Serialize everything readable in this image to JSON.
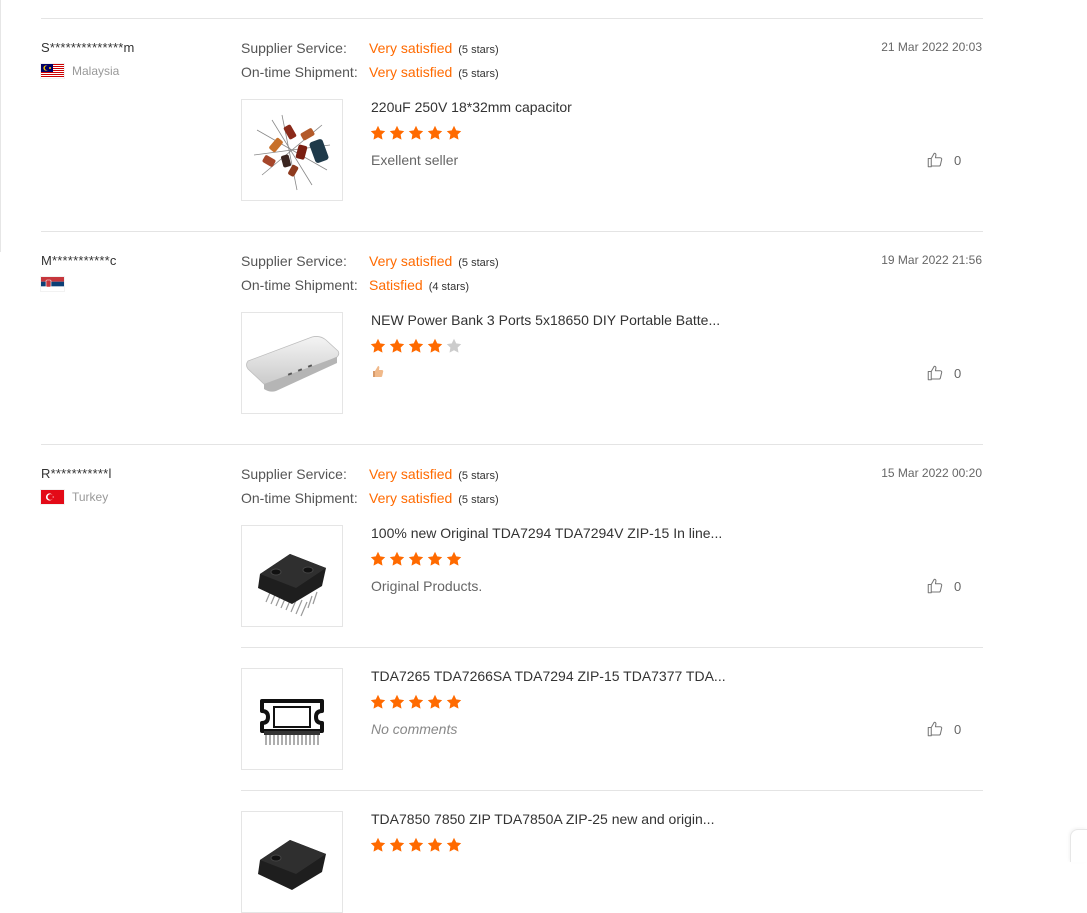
{
  "reviews": [
    {
      "buyer": "S**************m",
      "country": "Malaysia",
      "flag": "malaysia",
      "date": "21 Mar 2022 20:03",
      "supplier_label": "Supplier Service:",
      "supplier_value": "Very satisfied",
      "supplier_stars": "(5 stars)",
      "shipment_label": "On-time Shipment:",
      "shipment_value": "Very satisfied",
      "shipment_stars": "(5 stars)",
      "items": [
        {
          "title": "220uF 250V 18*32mm capacitor",
          "rating": 5,
          "comment": "Exellent seller",
          "likes": "0",
          "image": "capacitors-icon"
        }
      ]
    },
    {
      "buyer": "M***********c",
      "country": "",
      "flag": "serbia",
      "date": "19 Mar 2022 21:56",
      "supplier_label": "Supplier Service:",
      "supplier_value": "Very satisfied",
      "supplier_stars": "(5 stars)",
      "shipment_label": "On-time Shipment:",
      "shipment_value": "Satisfied",
      "shipment_stars": "(4 stars)",
      "items": [
        {
          "title": "NEW Power Bank 3 Ports 5x18650 DIY Portable Batte...",
          "rating": 4,
          "comment": "",
          "comment_emoji": "thumbs-up-emoji",
          "likes": "0",
          "image": "power-bank-icon"
        }
      ]
    },
    {
      "buyer": "R***********l",
      "country": "Turkey",
      "flag": "turkey",
      "date": "15 Mar 2022 00:20",
      "supplier_label": "Supplier Service:",
      "supplier_value": "Very satisfied",
      "supplier_stars": "(5 stars)",
      "shipment_label": "On-time Shipment:",
      "shipment_value": "Very satisfied",
      "shipment_stars": "(5 stars)",
      "items": [
        {
          "title": "100% new Original TDA7294 TDA7294V ZIP-15 In line...",
          "rating": 5,
          "comment": "Original Products.",
          "likes": "0",
          "image": "ic-chip-icon"
        },
        {
          "title": "TDA7265 TDA7266SA TDA7294 ZIP-15 TDA7377 TDA...",
          "rating": 5,
          "comment": "No comments",
          "likes": "0",
          "image": "ic-package-outline-icon"
        },
        {
          "title": "TDA7850 7850 ZIP TDA7850A ZIP-25 new and origin...",
          "rating": 5,
          "comment": "",
          "likes": "",
          "image": "ic-chip-icon"
        }
      ]
    }
  ],
  "colors": {
    "accent": "#ff6a00",
    "star_filled": "#ff6a00",
    "star_empty": "#cccccc",
    "divider": "#e4e4e4"
  }
}
